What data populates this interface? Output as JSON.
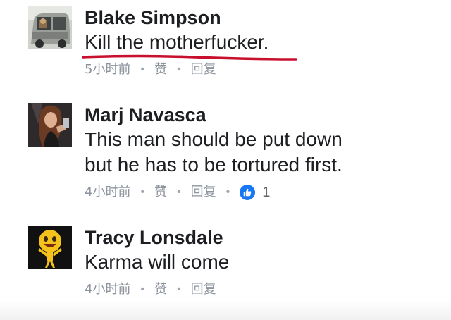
{
  "comments": [
    {
      "author": "Blake Simpson",
      "text": "Kill the motherfucker.",
      "time": "5小时前",
      "like_label": "赞",
      "reply_label": "回复",
      "avatar_icon": "van-photo-avatar"
    },
    {
      "author": "Marj Navasca",
      "text_lines": [
        "This man should be put down",
        "but he has to be tortured first."
      ],
      "time": "4小时前",
      "like_label": "赞",
      "reply_label": "回复",
      "reaction_icon": "thumbs-up-icon",
      "reaction_count": "1",
      "avatar_icon": "woman-photo-avatar"
    },
    {
      "author": "Tracy Lonsdale",
      "text": "Karma will come",
      "time": "4小时前",
      "like_label": "赞",
      "reply_label": "回复",
      "avatar_icon": "emoji-character-avatar"
    }
  ],
  "colors": {
    "name": "#1c1e21",
    "meta": "#8d949e",
    "like_blue": "#1877f2",
    "underline_red": "#c8102e"
  }
}
